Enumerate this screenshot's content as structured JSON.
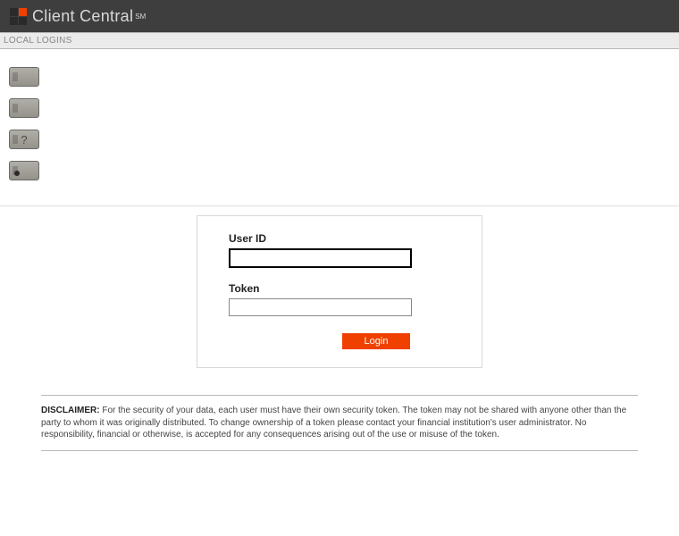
{
  "header": {
    "brand": "Client Central",
    "mark": "SM"
  },
  "subheader": {
    "text": "LOCAL LOGINS"
  },
  "login": {
    "user_label": "User ID",
    "user_value": "",
    "token_label": "Token",
    "token_value": "",
    "button_label": "Login"
  },
  "disclaimer": {
    "heading": "DISCLAIMER:",
    "body": "For the security of your data, each user must have their own security token. The token may not be shared with anyone other than the party to whom it was originally distributed. To change ownership of a token please contact your financial institution's user administrator. No responsibility, financial or otherwise, is accepted for any consequences arising out of the use or misuse of the token."
  },
  "colors": {
    "accent": "#f04000",
    "header_bg": "#3e3e3e"
  }
}
